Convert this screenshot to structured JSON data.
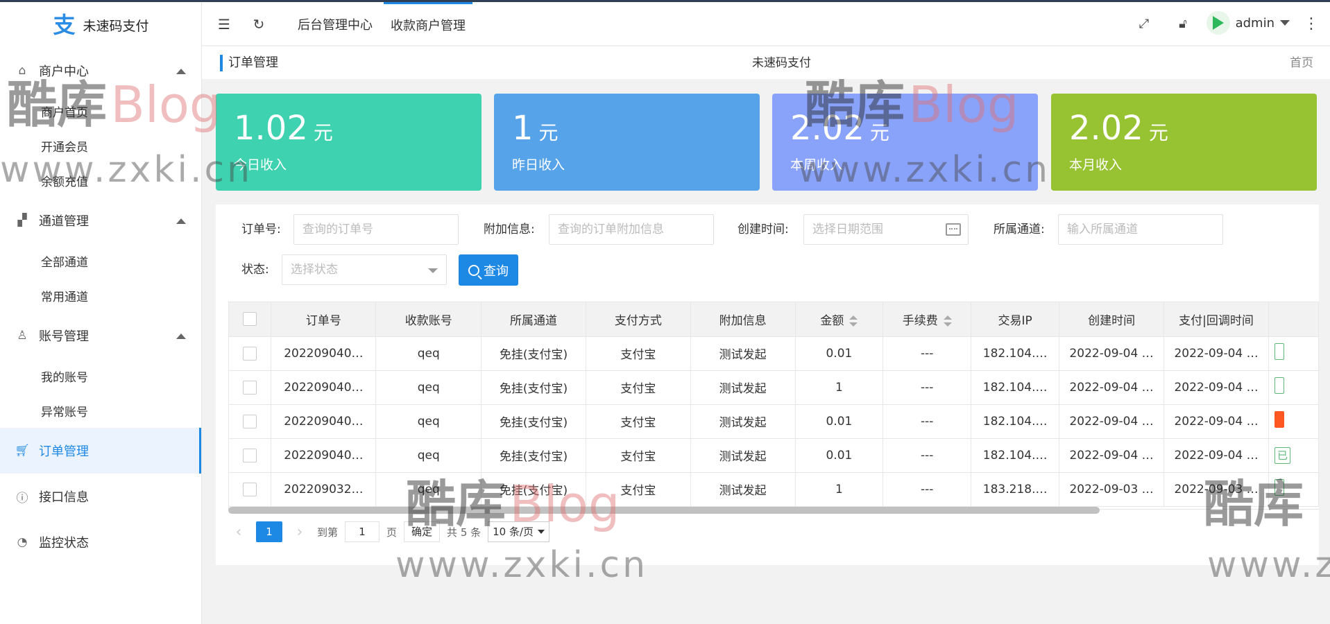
{
  "app": {
    "logo_mark": "支",
    "title": "未速码支付"
  },
  "sidebar": {
    "groups": [
      {
        "label": "商户中心",
        "icon": "home-icon",
        "items": [
          "商户首页",
          "开通会员",
          "余额充值"
        ]
      },
      {
        "label": "通道管理",
        "icon": "apps-icon",
        "items": [
          "全部通道",
          "常用通道"
        ]
      },
      {
        "label": "账号管理",
        "icon": "user-icon",
        "items": [
          "我的账号",
          "异常账号"
        ]
      }
    ],
    "singles": [
      {
        "label": "订单管理",
        "icon": "cart-icon",
        "active": true
      },
      {
        "label": "接口信息",
        "icon": "info-icon"
      },
      {
        "label": "监控状态",
        "icon": "gauge-icon"
      }
    ]
  },
  "header": {
    "tabs": [
      "后台管理中心",
      "收款商户管理"
    ],
    "user": "admin"
  },
  "breadcrumb": {
    "title": "订单管理",
    "center": "未速码支付",
    "home": "首页"
  },
  "cards": [
    {
      "amount": "1.02",
      "unit": "元",
      "label": "今日收入",
      "color": "#3fd2b0"
    },
    {
      "amount": "1",
      "unit": "元",
      "label": "昨日收入",
      "color": "#56a3ea"
    },
    {
      "amount": "2.02",
      "unit": "元",
      "label": "本周收入",
      "color": "#8aa3fa"
    },
    {
      "amount": "2.02",
      "unit": "元",
      "label": "本月收入",
      "color": "#97c232"
    }
  ],
  "filters": {
    "order_no": {
      "label": "订单号:",
      "placeholder": "查询的订单号"
    },
    "extra": {
      "label": "附加信息:",
      "placeholder": "查询的订单附加信息"
    },
    "created": {
      "label": "创建时间:",
      "placeholder": "选择日期范围"
    },
    "channel": {
      "label": "所属通道:",
      "placeholder": "输入所属通道"
    },
    "status": {
      "label": "状态:",
      "placeholder": "选择状态"
    },
    "query_label": "查询"
  },
  "table": {
    "columns": [
      "订单号",
      "收款账号",
      "所属通道",
      "支付方式",
      "附加信息",
      "金额",
      "手续费",
      "交易IP",
      "创建时间",
      "支付|回调时间"
    ],
    "rows": [
      {
        "order": "202209040…",
        "account": "qeq",
        "channel": "免挂(支付宝)",
        "method": "支付宝",
        "extra": "测试发起",
        "amount": "0.01",
        "fee": "---",
        "ip": "182.104.…",
        "created": "2022-09-04 …",
        "paid": "2022-09-04 …",
        "status": ""
      },
      {
        "order": "202209040…",
        "account": "qeq",
        "channel": "免挂(支付宝)",
        "method": "支付宝",
        "extra": "测试发起",
        "amount": "1",
        "fee": "---",
        "ip": "182.104.…",
        "created": "2022-09-04 …",
        "paid": "2022-09-04 …",
        "status": ""
      },
      {
        "order": "202209040…",
        "account": "qeq",
        "channel": "免挂(支付宝)",
        "method": "支付宝",
        "extra": "测试发起",
        "amount": "0.01",
        "fee": "---",
        "ip": "182.104.…",
        "created": "2022-09-04 …",
        "paid": "2022-09-04 …",
        "status": ""
      },
      {
        "order": "202209040…",
        "account": "qeq",
        "channel": "免挂(支付宝)",
        "method": "支付宝",
        "extra": "测试发起",
        "amount": "0.01",
        "fee": "---",
        "ip": "182.104.…",
        "created": "2022-09-04 …",
        "paid": "2022-09-04 …",
        "status": "已"
      },
      {
        "order": "202209032…",
        "account": "qeq",
        "channel": "免挂(支付宝)",
        "method": "支付宝",
        "extra": "测试发起",
        "amount": "1",
        "fee": "---",
        "ip": "183.218.…",
        "created": "2022-09-03 …",
        "paid": "2022-09-03 …",
        "status": ""
      }
    ]
  },
  "pager": {
    "current": "1",
    "goto": "到第",
    "goto_value": "1",
    "page_unit": "页",
    "confirm": "确定",
    "total": "共 5 条",
    "page_size": "10 条/页"
  },
  "watermark": {
    "cn": "酷库",
    "blog": "Blog",
    "url": "www.zxki.cn",
    "cn2": "酷库",
    "url_partial": "www.z"
  }
}
